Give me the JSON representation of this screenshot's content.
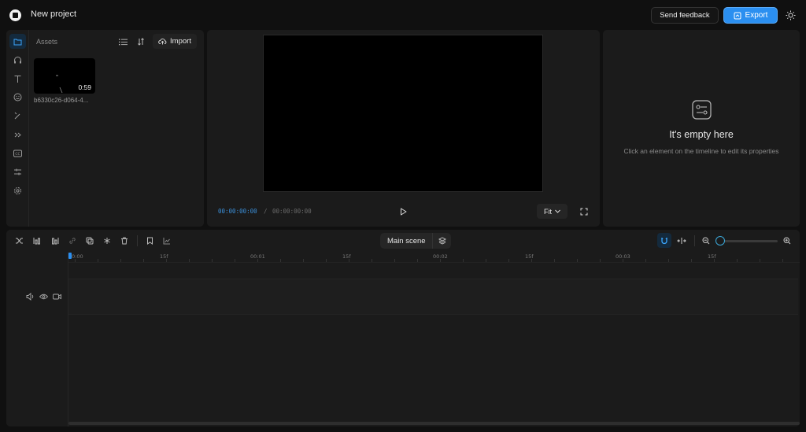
{
  "header": {
    "project_title": "New project",
    "feedback_label": "Send feedback",
    "export_label": "Export"
  },
  "sidebar": {
    "items": [
      {
        "name": "folder-icon",
        "active": true
      },
      {
        "name": "headphones-icon"
      },
      {
        "name": "text-icon"
      },
      {
        "name": "emoji-icon"
      },
      {
        "name": "magic-wand-icon"
      },
      {
        "name": "transitions-icon"
      },
      {
        "name": "captions-icon"
      },
      {
        "name": "adjustments-icon"
      },
      {
        "name": "settings-icon"
      }
    ]
  },
  "assets": {
    "title": "Assets",
    "import_label": "Import",
    "items": [
      {
        "name": "b6330c26-d064-4...",
        "duration": "0:59"
      }
    ]
  },
  "preview": {
    "current_time": "00:00:00:00",
    "separator": "/",
    "total_time": "00:00:00:00",
    "fit_label": "Fit"
  },
  "properties": {
    "empty_title": "It's empty here",
    "empty_subtitle": "Click an element on the timeline to edit its properties"
  },
  "timeline": {
    "scene_label": "Main scene",
    "ruler_labels": [
      "0:00",
      "15f",
      "00:01",
      "15f",
      "00:02",
      "15f",
      "00:03",
      "15f"
    ],
    "zoom_level": 0.0
  },
  "colors": {
    "accent": "#2b8ff0",
    "background": "#101010",
    "panel": "#1b1b1b"
  }
}
